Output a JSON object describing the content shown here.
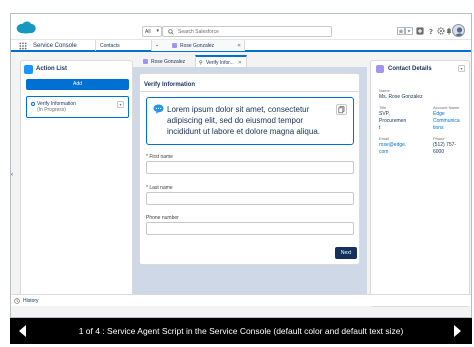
{
  "header": {
    "scope_label": "All",
    "search_placeholder": "Search Salesforce"
  },
  "nav": {
    "app_name": "Service Console",
    "tabs": [
      {
        "label": "Contacts"
      },
      {
        "label": "Rose Gonzalez"
      }
    ]
  },
  "action_list": {
    "title": "Action List",
    "add_label": "Add",
    "items": [
      {
        "title": "Verify Information",
        "status": "(In Progress)"
      }
    ]
  },
  "subtabs": [
    {
      "label": "Rose Gonzalez"
    },
    {
      "label": "Verify Infor..."
    }
  ],
  "script": {
    "title": "Verify Information",
    "prompt": "Lorem ipsum dolor sit amet, consectetur adipiscing elit, sed do eiusmod tempor incididunt ut labore et dolore magna aliqua.",
    "fields": [
      {
        "label": "* First name",
        "value": ""
      },
      {
        "label": "* Last name",
        "value": ""
      },
      {
        "label": "Phone number",
        "value": ""
      }
    ],
    "next_label": "Next"
  },
  "contact": {
    "title": "Contact Details",
    "name_label": "Name",
    "name_value": "Ms. Rose Gonzalez",
    "title_label": "Title",
    "title_value": [
      "SVP,",
      "Procuremen",
      "t"
    ],
    "account_label": "Account Name",
    "account_value": [
      "Edge",
      "Communica",
      "tions"
    ],
    "email_label": "Email",
    "email_value": [
      "rose@edge.",
      "com"
    ],
    "phone_label": "Phone",
    "phone_value": [
      "(512) 757-",
      "6000"
    ]
  },
  "footer": {
    "history_label": "History"
  },
  "caption": {
    "text": "1 of 4 : Service Agent Script in the Service Console (default color and default text size)"
  },
  "colors": {
    "brand": "#0070d2",
    "navy": "#16325c",
    "center_bg": "#cfd8e6",
    "caption_bg": "#000000"
  }
}
